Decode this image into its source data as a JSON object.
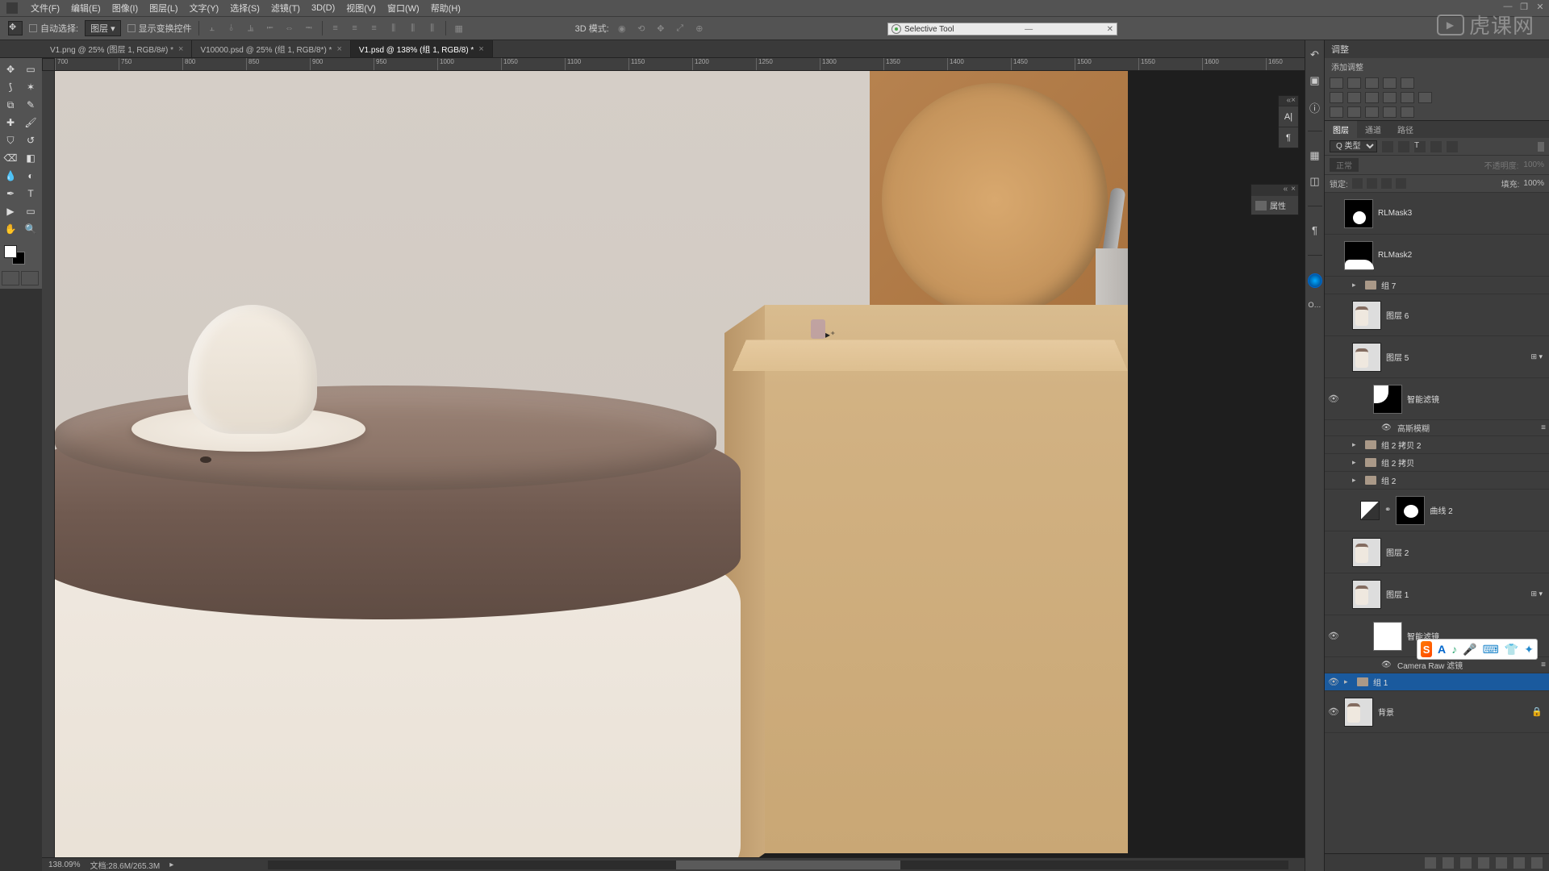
{
  "menu": {
    "file": "文件(F)",
    "edit": "编辑(E)",
    "image": "图像(I)",
    "layer": "图层(L)",
    "type": "文字(Y)",
    "select": "选择(S)",
    "filter": "滤镜(T)",
    "threed": "3D(D)",
    "view": "视图(V)",
    "window": "窗口(W)",
    "help": "帮助(H)"
  },
  "options": {
    "autoSelect": "自动选择:",
    "layerSel": "图层",
    "showTransform": "显示变换控件",
    "modeBtn": "3D 模式:"
  },
  "tabs": [
    {
      "label": "V1.png @ 25% (图层 1, RGB/8#) *",
      "active": false
    },
    {
      "label": "V10000.psd @ 25% (组 1, RGB/8*) *",
      "active": false
    },
    {
      "label": "V1.psd @ 138% (组 1, RGB/8) *",
      "active": true
    }
  ],
  "ruler": [
    "700",
    "750",
    "800",
    "850",
    "900",
    "950",
    "1000",
    "1050",
    "1100",
    "1150",
    "1200",
    "1250",
    "1300",
    "1350",
    "1400",
    "1450",
    "1500",
    "1550",
    "1600",
    "1650"
  ],
  "floatWin": {
    "title": "Selective Tool"
  },
  "floatProps": {
    "title": "属性"
  },
  "adjust": {
    "panel": "调整",
    "sub": "添加调整"
  },
  "layersPanel": {
    "tabs": {
      "layers": "图层",
      "channels": "通道",
      "paths": "路径"
    },
    "filterKind": "Q 类型",
    "blendMode": "正常",
    "opacityLbl": "不透明度:",
    "opacityVal": "100%",
    "lockLbl": "锁定:",
    "fillLbl": "填充:",
    "fillVal": "100%"
  },
  "layers": {
    "rlmask3": "RLMask3",
    "rlmask2": "RLMask2",
    "group7": "组 7",
    "layer6": "图层 6",
    "layer5": "图层 5",
    "smartFilters": "智能滤镜",
    "gaussian": "高斯模糊",
    "group2copy2": "组 2 拷贝 2",
    "group2copy": "组 2 拷贝",
    "group2": "组 2",
    "curves2": "曲线 2",
    "layer2": "图层 2",
    "layer1": "图层 1",
    "smartFilters2": "智能滤镜",
    "cameraRaw": "Camera Raw 滤镜",
    "group1": "组 1",
    "background": "背景"
  },
  "ime": {
    "logo": "S",
    "a": "A"
  },
  "status": {
    "zoom": "138.09%",
    "doc": "文档:28.6M/265.3M"
  },
  "watermark": "虎课网"
}
